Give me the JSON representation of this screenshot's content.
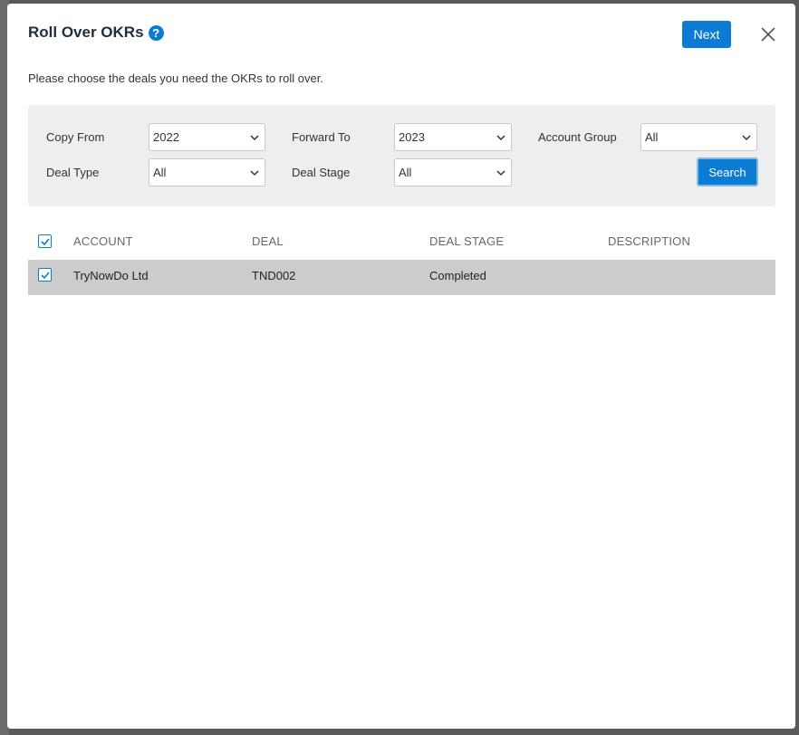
{
  "modal": {
    "title": "Roll Over OKRs",
    "next_label": "Next",
    "subtitle": "Please choose the deals you need the OKRs to roll over."
  },
  "filters": {
    "copy_from": {
      "label": "Copy From",
      "value": "2022"
    },
    "forward_to": {
      "label": "Forward To",
      "value": "2023"
    },
    "account_group": {
      "label": "Account Group",
      "value": "All"
    },
    "deal_type": {
      "label": "Deal Type",
      "value": "All"
    },
    "deal_stage": {
      "label": "Deal Stage",
      "value": "All"
    },
    "search_label": "Search"
  },
  "table": {
    "columns": [
      "ACCOUNT",
      "DEAL",
      "DEAL STAGE",
      "DESCRIPTION"
    ],
    "rows": [
      {
        "account": "TryNowDo Ltd",
        "deal": "TND002",
        "stage": "Completed",
        "description": "",
        "checked": true
      }
    ],
    "select_all_checked": true
  },
  "colors": {
    "accent": "#0b7bd4",
    "panel": "#eeeeee",
    "selected_row": "#cccccc"
  },
  "icons": {
    "help": "question-circle-icon",
    "close": "close-icon",
    "dropdown": "chevron-down-icon",
    "check": "check-icon"
  }
}
